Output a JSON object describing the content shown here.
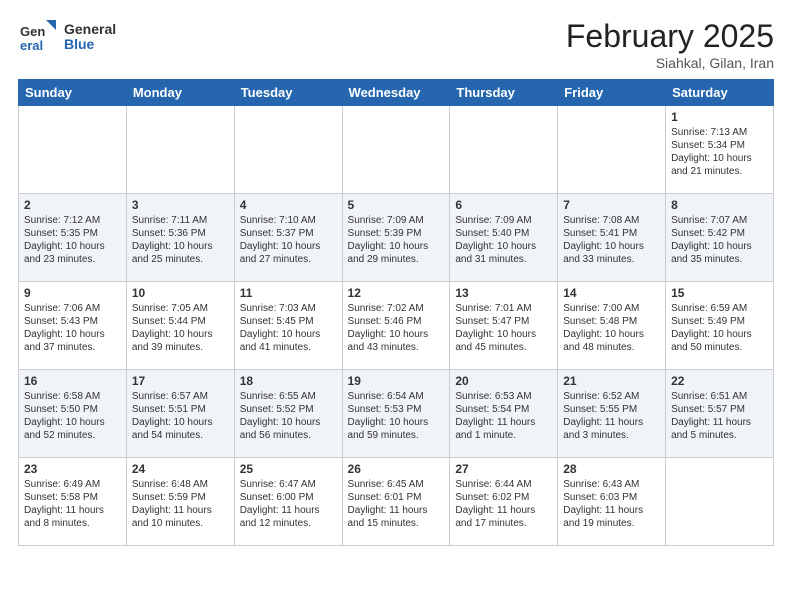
{
  "header": {
    "logo_general": "General",
    "logo_blue": "Blue",
    "cal_title": "February 2025",
    "cal_subtitle": "Siahkal, Gilan, Iran"
  },
  "days_of_week": [
    "Sunday",
    "Monday",
    "Tuesday",
    "Wednesday",
    "Thursday",
    "Friday",
    "Saturday"
  ],
  "weeks": [
    [
      {
        "day": "",
        "info": ""
      },
      {
        "day": "",
        "info": ""
      },
      {
        "day": "",
        "info": ""
      },
      {
        "day": "",
        "info": ""
      },
      {
        "day": "",
        "info": ""
      },
      {
        "day": "",
        "info": ""
      },
      {
        "day": "1",
        "info": "Sunrise: 7:13 AM\nSunset: 5:34 PM\nDaylight: 10 hours and 21 minutes."
      }
    ],
    [
      {
        "day": "2",
        "info": "Sunrise: 7:12 AM\nSunset: 5:35 PM\nDaylight: 10 hours and 23 minutes."
      },
      {
        "day": "3",
        "info": "Sunrise: 7:11 AM\nSunset: 5:36 PM\nDaylight: 10 hours and 25 minutes."
      },
      {
        "day": "4",
        "info": "Sunrise: 7:10 AM\nSunset: 5:37 PM\nDaylight: 10 hours and 27 minutes."
      },
      {
        "day": "5",
        "info": "Sunrise: 7:09 AM\nSunset: 5:39 PM\nDaylight: 10 hours and 29 minutes."
      },
      {
        "day": "6",
        "info": "Sunrise: 7:09 AM\nSunset: 5:40 PM\nDaylight: 10 hours and 31 minutes."
      },
      {
        "day": "7",
        "info": "Sunrise: 7:08 AM\nSunset: 5:41 PM\nDaylight: 10 hours and 33 minutes."
      },
      {
        "day": "8",
        "info": "Sunrise: 7:07 AM\nSunset: 5:42 PM\nDaylight: 10 hours and 35 minutes."
      }
    ],
    [
      {
        "day": "9",
        "info": "Sunrise: 7:06 AM\nSunset: 5:43 PM\nDaylight: 10 hours and 37 minutes."
      },
      {
        "day": "10",
        "info": "Sunrise: 7:05 AM\nSunset: 5:44 PM\nDaylight: 10 hours and 39 minutes."
      },
      {
        "day": "11",
        "info": "Sunrise: 7:03 AM\nSunset: 5:45 PM\nDaylight: 10 hours and 41 minutes."
      },
      {
        "day": "12",
        "info": "Sunrise: 7:02 AM\nSunset: 5:46 PM\nDaylight: 10 hours and 43 minutes."
      },
      {
        "day": "13",
        "info": "Sunrise: 7:01 AM\nSunset: 5:47 PM\nDaylight: 10 hours and 45 minutes."
      },
      {
        "day": "14",
        "info": "Sunrise: 7:00 AM\nSunset: 5:48 PM\nDaylight: 10 hours and 48 minutes."
      },
      {
        "day": "15",
        "info": "Sunrise: 6:59 AM\nSunset: 5:49 PM\nDaylight: 10 hours and 50 minutes."
      }
    ],
    [
      {
        "day": "16",
        "info": "Sunrise: 6:58 AM\nSunset: 5:50 PM\nDaylight: 10 hours and 52 minutes."
      },
      {
        "day": "17",
        "info": "Sunrise: 6:57 AM\nSunset: 5:51 PM\nDaylight: 10 hours and 54 minutes."
      },
      {
        "day": "18",
        "info": "Sunrise: 6:55 AM\nSunset: 5:52 PM\nDaylight: 10 hours and 56 minutes."
      },
      {
        "day": "19",
        "info": "Sunrise: 6:54 AM\nSunset: 5:53 PM\nDaylight: 10 hours and 59 minutes."
      },
      {
        "day": "20",
        "info": "Sunrise: 6:53 AM\nSunset: 5:54 PM\nDaylight: 11 hours and 1 minute."
      },
      {
        "day": "21",
        "info": "Sunrise: 6:52 AM\nSunset: 5:55 PM\nDaylight: 11 hours and 3 minutes."
      },
      {
        "day": "22",
        "info": "Sunrise: 6:51 AM\nSunset: 5:57 PM\nDaylight: 11 hours and 5 minutes."
      }
    ],
    [
      {
        "day": "23",
        "info": "Sunrise: 6:49 AM\nSunset: 5:58 PM\nDaylight: 11 hours and 8 minutes."
      },
      {
        "day": "24",
        "info": "Sunrise: 6:48 AM\nSunset: 5:59 PM\nDaylight: 11 hours and 10 minutes."
      },
      {
        "day": "25",
        "info": "Sunrise: 6:47 AM\nSunset: 6:00 PM\nDaylight: 11 hours and 12 minutes."
      },
      {
        "day": "26",
        "info": "Sunrise: 6:45 AM\nSunset: 6:01 PM\nDaylight: 11 hours and 15 minutes."
      },
      {
        "day": "27",
        "info": "Sunrise: 6:44 AM\nSunset: 6:02 PM\nDaylight: 11 hours and 17 minutes."
      },
      {
        "day": "28",
        "info": "Sunrise: 6:43 AM\nSunset: 6:03 PM\nDaylight: 11 hours and 19 minutes."
      },
      {
        "day": "",
        "info": ""
      }
    ]
  ]
}
